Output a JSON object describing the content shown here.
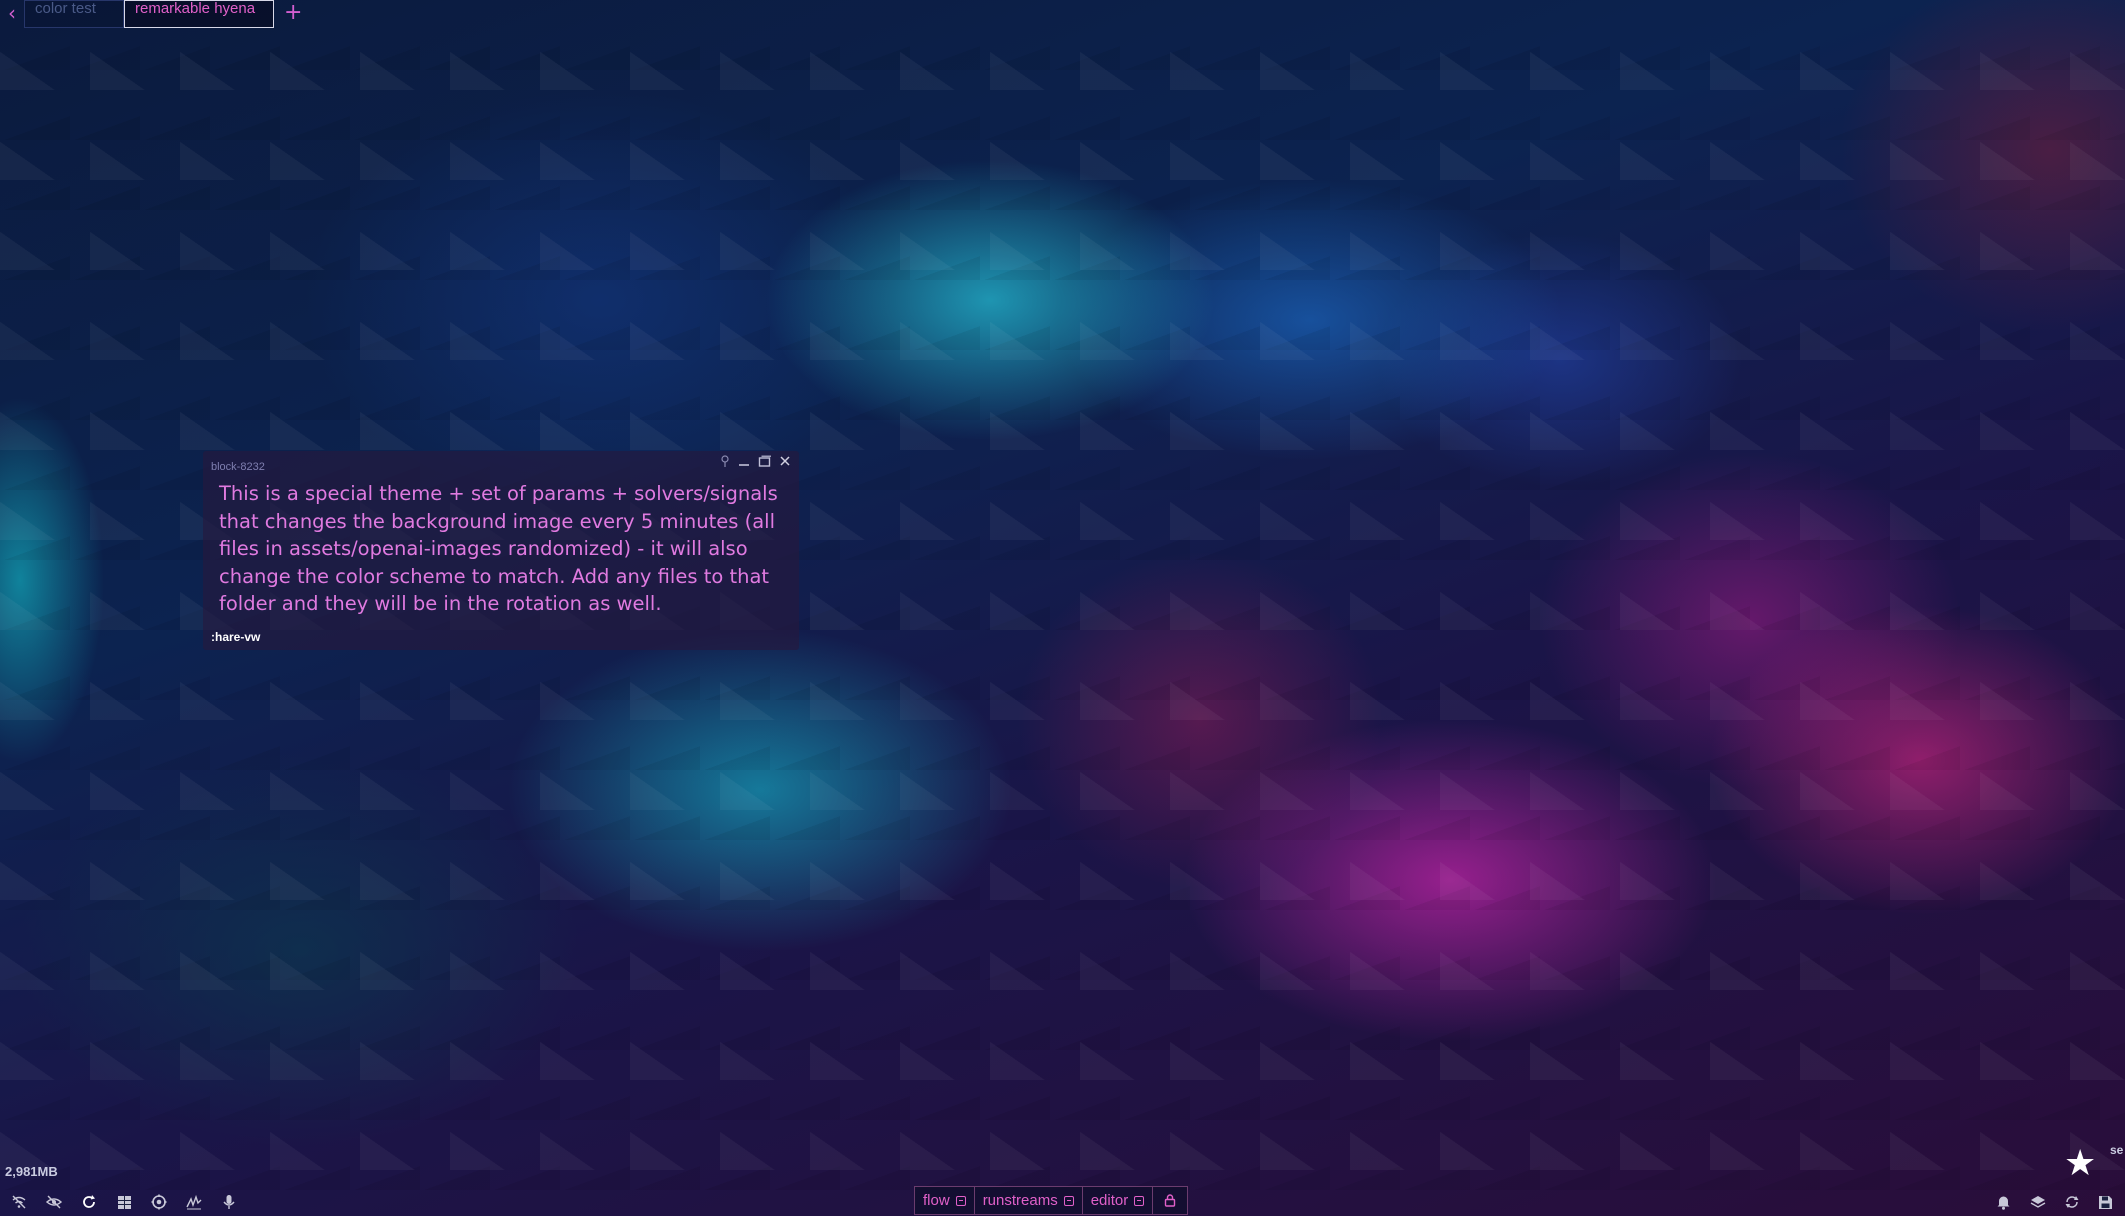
{
  "tabs": {
    "back_icon": "chevron-left-icon",
    "items": [
      {
        "label": "color test",
        "active": false
      },
      {
        "label": "remarkable hyena",
        "active": true
      }
    ],
    "add_label": "+"
  },
  "block": {
    "id": "block-8232",
    "text": "This is a special theme + set of params + solvers/signals that changes the background image every 5 minutes (all files in assets/openai-images randomized) - it will also change the color scheme to match. Add any files to that folder and they will be in the rotation as well.",
    "footer": ":hare-vw",
    "controls": [
      "pin-icon",
      "minimize-icon",
      "maximize-icon",
      "close-icon"
    ]
  },
  "status": {
    "memory": "2,981MB",
    "corner_text": "se"
  },
  "bottom_tabs": [
    {
      "label": "flow",
      "icon": "open-panel-icon"
    },
    {
      "label": "runstreams",
      "icon": "open-panel-icon"
    },
    {
      "label": "editor",
      "icon": "open-panel-icon"
    },
    {
      "label": "",
      "icon": "lock-icon"
    }
  ],
  "bottom_left_icons": [
    "wifi-off-icon",
    "eye-off-icon",
    "refresh-icon",
    "grid-icon",
    "settings-icon",
    "signature-icon",
    "microphone-icon"
  ],
  "bottom_right_icons": [
    "bell-icon",
    "layers-icon",
    "sync-icon",
    "save-icon"
  ],
  "colors": {
    "accent": "#e060c8",
    "text_pink": "#e07ae0",
    "tab_border": "#6b3c6e"
  }
}
